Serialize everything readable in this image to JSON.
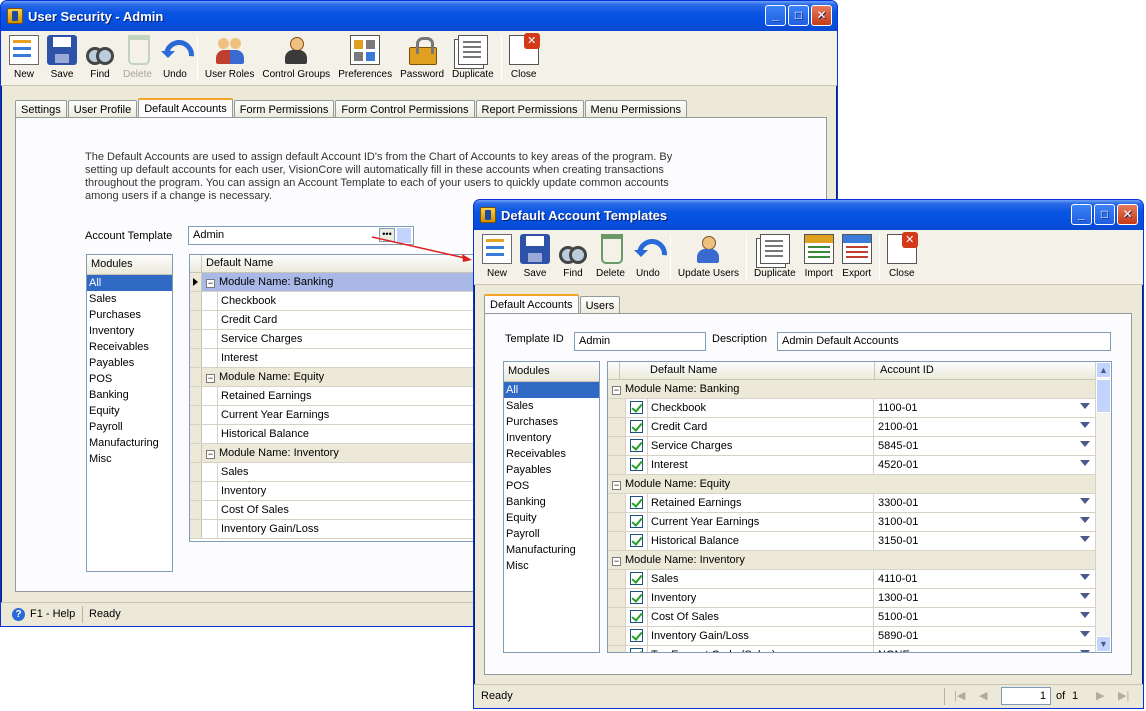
{
  "main_window": {
    "title": "User Security - Admin",
    "toolbar": [
      {
        "label": "New",
        "icon": "new-icon"
      },
      {
        "label": "Save",
        "icon": "save-icon"
      },
      {
        "label": "Find",
        "icon": "find-icon"
      },
      {
        "label": "Delete",
        "icon": "delete-icon",
        "disabled": true
      },
      {
        "label": "Undo",
        "icon": "undo-icon"
      },
      {
        "label": "User Roles",
        "icon": "user-roles-icon"
      },
      {
        "label": "Control Groups",
        "icon": "control-groups-icon"
      },
      {
        "label": "Preferences",
        "icon": "preferences-icon"
      },
      {
        "label": "Password",
        "icon": "password-icon"
      },
      {
        "label": "Duplicate",
        "icon": "duplicate-icon"
      },
      {
        "label": "Close",
        "icon": "close-icon"
      }
    ],
    "tabs": [
      "Settings",
      "User Profile",
      "Default Accounts",
      "Form Permissions",
      "Form Control Permissions",
      "Report Permissions",
      "Menu Permissions"
    ],
    "active_tab": "Default Accounts",
    "description": "The Default Accounts are used to assign default Account ID's from the Chart of Accounts to key areas of the program.  By setting up default accounts for each user, VisionCore will automatically fill in these accounts when creating transactions throughout the program.  You can assign an Account Template to each of your users to quickly update common accounts among users if a change is necessary.",
    "account_template_label": "Account Template",
    "account_template_value": "Admin",
    "modules_header": "Modules",
    "modules": [
      "All",
      "Sales",
      "Purchases",
      "Inventory",
      "Receivables",
      "Payables",
      "POS",
      "Banking",
      "Equity",
      "Payroll",
      "Manufacturing",
      "Misc"
    ],
    "grid_header": "Default Name",
    "groups": [
      {
        "name": "Module Name: Banking",
        "items": [
          "Checkbook",
          "Credit Card",
          "Service Charges",
          "Interest"
        ]
      },
      {
        "name": "Module Name: Equity",
        "items": [
          "Retained Earnings",
          "Current Year Earnings",
          "Historical Balance"
        ]
      },
      {
        "name": "Module Name: Inventory",
        "items": [
          "Sales",
          "Inventory",
          "Cost Of Sales",
          "Inventory Gain/Loss"
        ]
      }
    ],
    "status": {
      "help": "F1 - Help",
      "text": "Ready"
    }
  },
  "template_window": {
    "title": "Default Account Templates",
    "toolbar": [
      {
        "label": "New",
        "icon": "new-icon"
      },
      {
        "label": "Save",
        "icon": "save-icon"
      },
      {
        "label": "Find",
        "icon": "find-icon"
      },
      {
        "label": "Delete",
        "icon": "delete-icon"
      },
      {
        "label": "Undo",
        "icon": "undo-icon"
      },
      {
        "label": "Update Users",
        "icon": "update-users-icon"
      },
      {
        "label": "Duplicate",
        "icon": "duplicate-icon"
      },
      {
        "label": "Import",
        "icon": "import-icon"
      },
      {
        "label": "Export",
        "icon": "export-icon"
      },
      {
        "label": "Close",
        "icon": "close-icon"
      }
    ],
    "tabs": [
      "Default Accounts",
      "Users"
    ],
    "active_tab": "Default Accounts",
    "template_id_label": "Template ID",
    "template_id_value": "Admin",
    "description_label": "Description",
    "description_value": "Admin Default Accounts",
    "modules_header": "Modules",
    "modules": [
      "All",
      "Sales",
      "Purchases",
      "Inventory",
      "Receivables",
      "Payables",
      "POS",
      "Banking",
      "Equity",
      "Payroll",
      "Manufacturing",
      "Misc"
    ],
    "grid_headers": {
      "name": "Default Name",
      "account": "Account ID"
    },
    "groups": [
      {
        "name": "Module Name: Banking",
        "items": [
          {
            "name": "Checkbook",
            "account": "1100-01"
          },
          {
            "name": "Credit Card",
            "account": "2100-01"
          },
          {
            "name": "Service Charges",
            "account": "5845-01"
          },
          {
            "name": "Interest",
            "account": "4520-01"
          }
        ]
      },
      {
        "name": "Module Name: Equity",
        "items": [
          {
            "name": "Retained Earnings",
            "account": "3300-01"
          },
          {
            "name": "Current Year Earnings",
            "account": "3100-01"
          },
          {
            "name": "Historical Balance",
            "account": "3150-01"
          }
        ]
      },
      {
        "name": "Module Name: Inventory",
        "items": [
          {
            "name": "Sales",
            "account": "4110-01"
          },
          {
            "name": "Inventory",
            "account": "1300-01"
          },
          {
            "name": "Cost Of Sales",
            "account": "5100-01"
          },
          {
            "name": "Inventory Gain/Loss",
            "account": "5890-01"
          },
          {
            "name": "Tax Exempt Code (Sales)",
            "account": "NONE"
          }
        ]
      }
    ],
    "status": {
      "text": "Ready",
      "page": "1",
      "of_label": "of",
      "total": "1"
    }
  },
  "colors": {
    "selection": "#316ac5",
    "title_blue": "#0a55e4",
    "arrow": "#e02020"
  }
}
